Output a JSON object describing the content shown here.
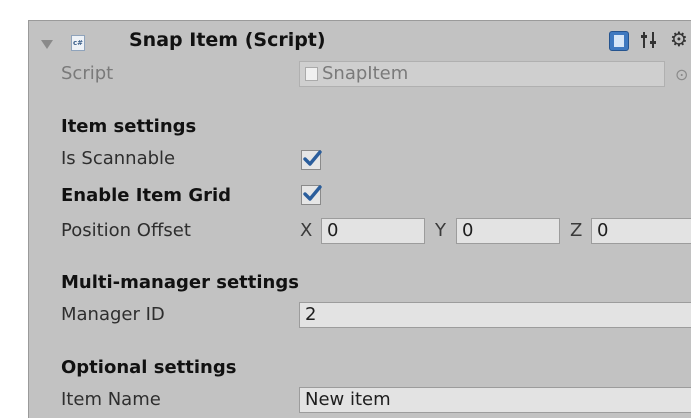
{
  "component": {
    "title": "Snap Item (Script)",
    "icon": "csharp-script-icon",
    "toolbar_icons": [
      "help-book-icon",
      "presets-icon",
      "gear-icon"
    ]
  },
  "script_field": {
    "label": "Script",
    "value": "SnapItem"
  },
  "item_settings": {
    "header": "Item settings",
    "is_scannable_label": "Is Scannable",
    "is_scannable": true,
    "enable_grid_label": "Enable Item Grid",
    "enable_grid": true,
    "position_offset_label": "Position Offset",
    "x_label": "X",
    "x_value": "0",
    "y_label": "Y",
    "y_value": "0",
    "z_label": "Z",
    "z_value": "0"
  },
  "multi_manager": {
    "header": "Multi-manager settings",
    "manager_id_label": "Manager ID",
    "manager_id_value": "2"
  },
  "optional": {
    "header": "Optional settings",
    "item_name_label": "Item Name",
    "item_name_value": "New item"
  },
  "colors": {
    "panel_bg": "#c2c2c2",
    "field_bg": "#e3e3e3",
    "check_blue": "#2b5e9c"
  }
}
